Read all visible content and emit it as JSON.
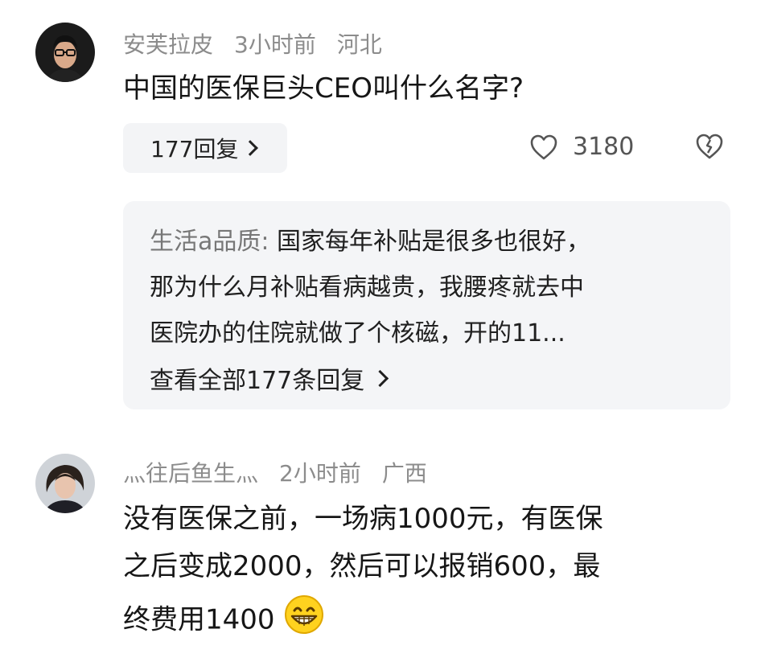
{
  "comments": [
    {
      "username": "安芙拉皮",
      "time": "3小时前",
      "location": "河北",
      "text": "中国的医保巨头CEO叫什么名字?",
      "replies_button": "177回复",
      "like_count": "3180",
      "top_reply": {
        "author": "生活a品质:",
        "lines": [
          " 国家每年补贴是很多也很好，",
          "那为什么月补贴看病越贵，我腰疼就去中",
          "医院办的住院就做了个核磁，开的11..."
        ],
        "view_all": "查看全部177条回复"
      }
    },
    {
      "username": "灬往后鱼生灬",
      "time": "2小时前",
      "location": "广西",
      "lines": [
        "没有医保之前，一场病1000元，有医保",
        "之后变成2000，然后可以报销600，最",
        "终费用1400"
      ],
      "emoji": "grinning-face-with-smiling-eyes"
    }
  ],
  "icons": {
    "like": "heart-outline-icon",
    "dislike": "broken-heart-icon",
    "chevron": "chevron-right-icon"
  },
  "colors": {
    "meta": "#8c8c8c",
    "reply_bg": "#f4f5f7"
  }
}
